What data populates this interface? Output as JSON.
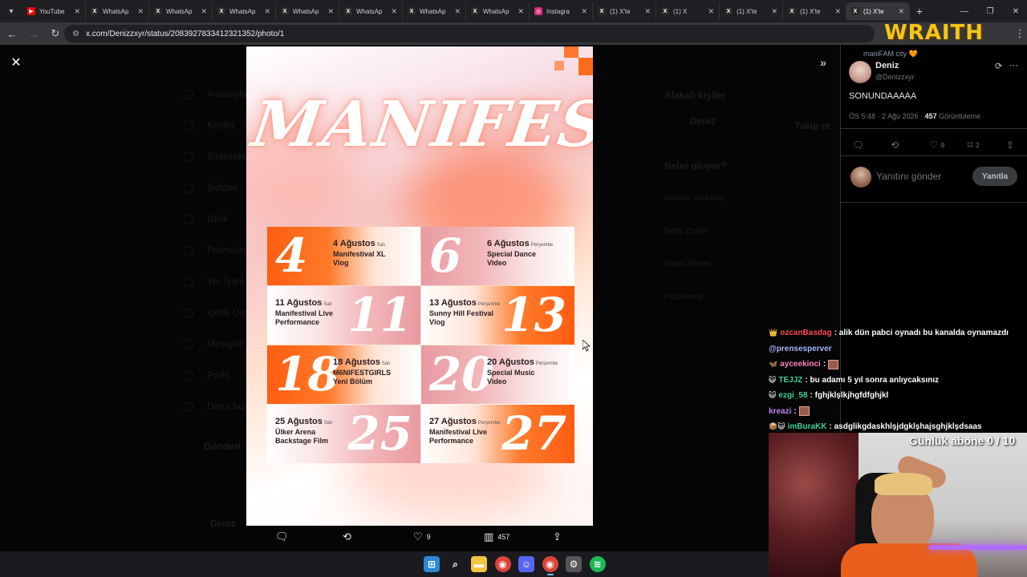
{
  "browser": {
    "tabs": [
      {
        "label": "YouTube",
        "icon": "youtube-icon",
        "color": "#ff0000"
      },
      {
        "label": "WhatsAp",
        "icon": "x-icon",
        "color": "#2a2a2a"
      },
      {
        "label": "WhatsAp",
        "icon": "x-icon",
        "color": "#2a2a2a"
      },
      {
        "label": "WhatsAp",
        "icon": "x-icon",
        "color": "#2a2a2a"
      },
      {
        "label": "WhatsAp",
        "icon": "x-icon",
        "color": "#2a2a2a"
      },
      {
        "label": "WhatsAp",
        "icon": "x-icon",
        "color": "#2a2a2a"
      },
      {
        "label": "WhatsAp",
        "icon": "x-icon",
        "color": "#2a2a2a"
      },
      {
        "label": "WhatsAp",
        "icon": "x-icon",
        "color": "#2a2a2a"
      },
      {
        "label": "Instagra",
        "icon": "instagram-icon",
        "color": "#d62976"
      },
      {
        "label": "(1) X'te",
        "icon": "x-icon",
        "color": "#2a2a2a"
      },
      {
        "label": "(1) X",
        "icon": "x-icon",
        "color": "#2a2a2a"
      },
      {
        "label": "(1) X'te",
        "icon": "x-icon",
        "color": "#2a2a2a"
      },
      {
        "label": "(1) X'te",
        "icon": "x-icon",
        "color": "#2a2a2a"
      },
      {
        "label": "(1) X'te",
        "icon": "x-icon",
        "color": "#2a2a2a",
        "active": true
      }
    ],
    "url": "x.com/Denizzxyr/status/2083927833412321352/photo/1"
  },
  "photo": {
    "title": "MANIFEST",
    "schedule": [
      {
        "num": "4",
        "date": "4 Ağustos",
        "day": "Salı",
        "line1": "Manifestival XL",
        "line2": "Vlog",
        "style": "orange-l",
        "num_side": "left"
      },
      {
        "num": "6",
        "date": "6 Ağustos",
        "day": "Perşembe",
        "line1": "Special Dance",
        "line2": "Video",
        "style": "pink-l",
        "num_side": "left"
      },
      {
        "num": "11",
        "date": "11 Ağustos",
        "day": "Salı",
        "line1": "Manifestival Live",
        "line2": "Performance",
        "style": "pink-r",
        "num_side": "right"
      },
      {
        "num": "13",
        "date": "13 Ağustos",
        "day": "Perşembe",
        "line1": "Sunny Hill Festival",
        "line2": "Vlog",
        "style": "orange-r",
        "num_side": "right"
      },
      {
        "num": "18",
        "date": "18 Ağustos",
        "day": "Salı",
        "line1": "M6NIFESTGIRLS",
        "line2": "Yeni Bölüm",
        "style": "orange-l",
        "num_side": "left"
      },
      {
        "num": "20",
        "date": "20 Ağustos",
        "day": "Perşembe",
        "line1": "Special Music",
        "line2": "Video",
        "style": "pink-l",
        "num_side": "left"
      },
      {
        "num": "25",
        "date": "25 Ağustos",
        "day": "Salı",
        "line1": "Ülker Arena",
        "line2": "Backstage Film",
        "style": "pink-r",
        "num_side": "right"
      },
      {
        "num": "27",
        "date": "27 Ağustos",
        "day": "Perşembe",
        "line1": "Manifestival Live",
        "line2": "Performance",
        "style": "orange-r",
        "num_side": "right"
      }
    ]
  },
  "photo_actions": {
    "replies": "",
    "reposts": "",
    "likes": "9",
    "views": "457"
  },
  "tweet": {
    "social_context": "maniFAM city 🧡",
    "name": "Deniz",
    "handle": "@Denizzxyr",
    "text": "SONUNDAAAAA",
    "time": "ÖS 5:48 · 2 Ağu 2026 · ",
    "views_count": "457",
    "views_label": " Görüntüleme",
    "likes": "9",
    "bookmarks": "2",
    "reply_placeholder": "Yanıtını gönder",
    "reply_button": "Yanıtla"
  },
  "background_ghost": {
    "nav": [
      "Anasayfa",
      "Keşfet",
      "Bildirimler",
      "Sohbet",
      "Grok",
      "Premium",
      "Yer İşaretleri",
      "İçerik Üreticisi",
      "Mesajlar",
      "Profil",
      "Daha fazla"
    ],
    "right_title": "Alakalı kişiler",
    "right_name": "Deniz",
    "happening": "Neler oluyor?",
    "trends": [
      "Nicolas Jackson",
      "Nehir Zeytin",
      "Bayırı Ahmet",
      "Pazarlama"
    ],
    "post_button": "Gönderi",
    "follow_button": "Takip et",
    "profile_label": "Deniz"
  },
  "overlay": {
    "logo": "WRAITH",
    "chat": [
      {
        "badge": "👑",
        "user": "ozcanBasdag",
        "user_color": "#ff4d4d",
        "msg": ": alik dün pabci oynadı bu kanalda oynamazdı",
        "emote": false
      },
      {
        "badge": "",
        "user": "@prensesperver",
        "user_color": "#a9b8ff",
        "msg": "",
        "emote": false
      },
      {
        "badge": "🦋",
        "user": "ayceekinci",
        "user_color": "#ff85c0",
        "msg": " :",
        "emote": true
      },
      {
        "badge": "😺",
        "user": "TEJJZ",
        "user_color": "#3fd0a0",
        "msg": ": bu adamı 5 yıl sonra anlıycaksınız",
        "emote": false
      },
      {
        "badge": "😺",
        "user": "ezgi_58",
        "user_color": "#3fd0a0",
        "msg": ": fghjklşlkjhgfdfghjkl",
        "emote": false
      },
      {
        "badge": "",
        "user": "kreazi",
        "user_color": "#c084fc",
        "msg": " :",
        "emote": true
      },
      {
        "badge": "📦😺",
        "user": "imBuraKK",
        "user_color": "#3fd0a0",
        "msg": ": asdglikgdaskhlşjdgklşhajsghjklşdsaas",
        "emote": false
      }
    ],
    "sub_goal": "Günlük abone 0 / 10"
  },
  "colors": {
    "accent_orange": "#ff5d11",
    "pink": "#e89aa0",
    "x_bg": "#000000",
    "logo_yellow": "#f5c518"
  },
  "taskbar": {
    "icons": [
      "windows-start-icon",
      "search-icon",
      "file-explorer-icon",
      "chrome-icon",
      "discord-icon",
      "chrome-icon",
      "steelseries-icon",
      "spotify-icon"
    ]
  }
}
